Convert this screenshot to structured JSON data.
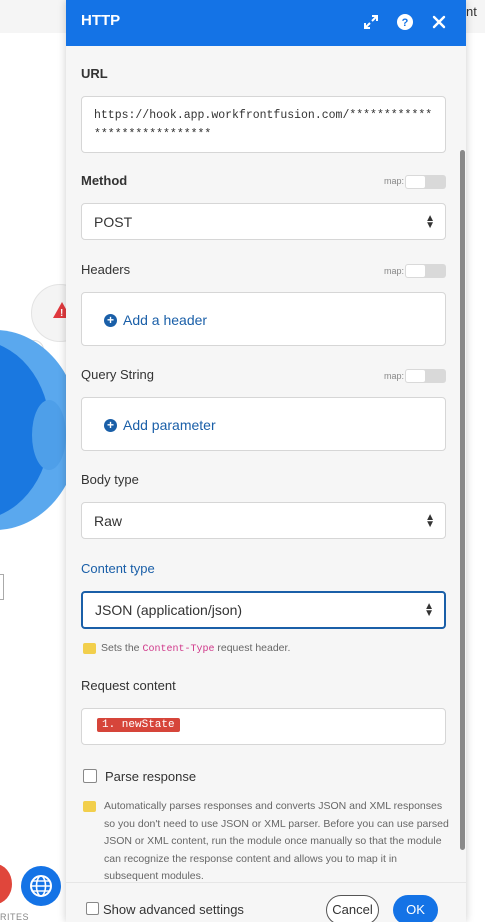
{
  "background": {
    "corner_text": "nt",
    "favorites_label": "RITES"
  },
  "panel": {
    "title": "HTTP",
    "icons": {
      "expand": "expand-icon",
      "help": "help-icon",
      "close": "close-icon"
    },
    "url": {
      "label": "URL",
      "value": "https://hook.app.workfrontfusion.com/*****************************"
    },
    "method": {
      "label": "Method",
      "map_label": "map:",
      "value": "POST"
    },
    "headers": {
      "label": "Headers",
      "map_label": "map:",
      "add_label": "Add a header"
    },
    "query_string": {
      "label": "Query String",
      "map_label": "map:",
      "add_label": "Add parameter"
    },
    "body_type": {
      "label": "Body type",
      "value": "Raw"
    },
    "content_type": {
      "label": "Content type",
      "value": "JSON (application/json)",
      "hint_prefix": "Sets the ",
      "hint_code": "Content-Type",
      "hint_suffix": " request header."
    },
    "request_content": {
      "label": "Request content",
      "pill": "1. newState"
    },
    "parse_response": {
      "label": "Parse response",
      "checked": false,
      "description": "Automatically parses responses and converts JSON and XML responses so you don't need to use JSON or XML parser. Before you can use parsed JSON or XML content, run the module once manually so that the module can recognize the response content and allows you to map it in subsequent modules."
    },
    "footer": {
      "advanced_label": "Show advanced settings",
      "cancel_label": "Cancel",
      "ok_label": "OK"
    }
  },
  "colors": {
    "header_blue": "#1473e6",
    "link_blue": "#1a5fa8",
    "pill_red": "#d6453a",
    "hint_yellow": "#f2cf4c"
  }
}
